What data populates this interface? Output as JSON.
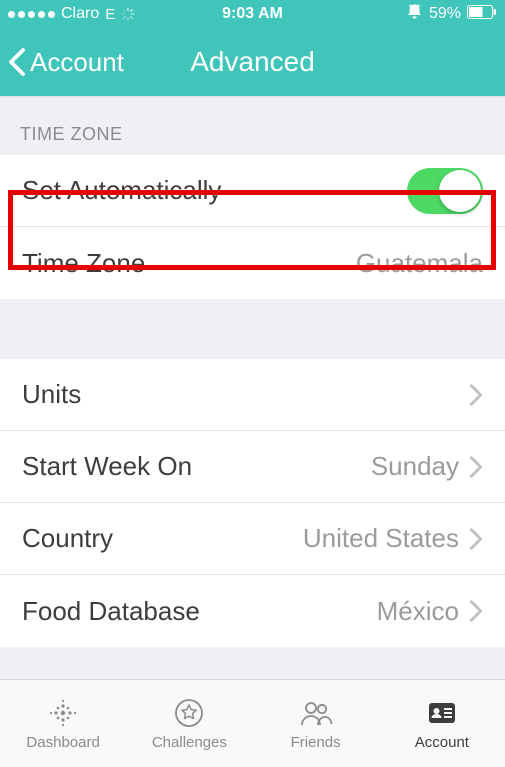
{
  "status": {
    "carrier": "Claro",
    "network": "E",
    "time": "9:03 AM",
    "battery_pct": "59%"
  },
  "nav": {
    "back_label": "Account",
    "title": "Advanced"
  },
  "sections": {
    "timezone_header": "TIME ZONE",
    "set_auto_label": "Set Automatically",
    "set_auto_on": true,
    "timezone_label": "Time Zone",
    "timezone_value": "Guatemala",
    "units_label": "Units",
    "start_week_label": "Start Week On",
    "start_week_value": "Sunday",
    "country_label": "Country",
    "country_value": "United States",
    "food_db_label": "Food Database",
    "food_db_value": "México"
  },
  "tabs": {
    "dashboard": "Dashboard",
    "challenges": "Challenges",
    "friends": "Friends",
    "account": "Account"
  }
}
